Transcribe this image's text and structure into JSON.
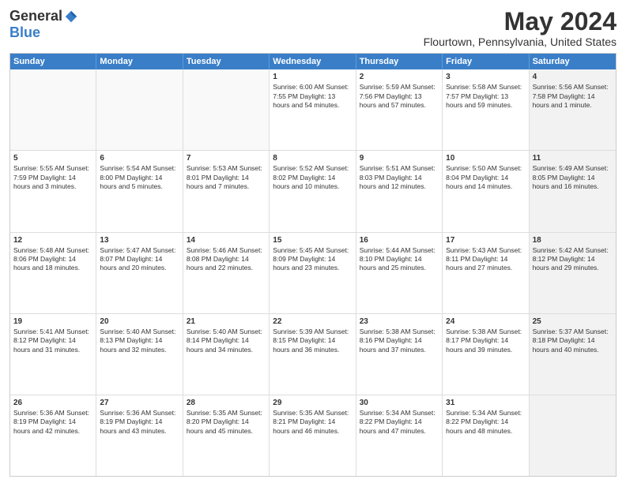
{
  "header": {
    "logo": {
      "general": "General",
      "blue": "Blue"
    },
    "title": "May 2024",
    "location": "Flourtown, Pennsylvania, United States"
  },
  "weekdays": [
    "Sunday",
    "Monday",
    "Tuesday",
    "Wednesday",
    "Thursday",
    "Friday",
    "Saturday"
  ],
  "rows": [
    [
      {
        "day": "",
        "info": "",
        "empty": true
      },
      {
        "day": "",
        "info": "",
        "empty": true
      },
      {
        "day": "",
        "info": "",
        "empty": true
      },
      {
        "day": "1",
        "info": "Sunrise: 6:00 AM\nSunset: 7:55 PM\nDaylight: 13 hours\nand 54 minutes.",
        "empty": false
      },
      {
        "day": "2",
        "info": "Sunrise: 5:59 AM\nSunset: 7:56 PM\nDaylight: 13 hours\nand 57 minutes.",
        "empty": false
      },
      {
        "day": "3",
        "info": "Sunrise: 5:58 AM\nSunset: 7:57 PM\nDaylight: 13 hours\nand 59 minutes.",
        "empty": false
      },
      {
        "day": "4",
        "info": "Sunrise: 5:56 AM\nSunset: 7:58 PM\nDaylight: 14 hours\nand 1 minute.",
        "empty": false,
        "shaded": true
      }
    ],
    [
      {
        "day": "5",
        "info": "Sunrise: 5:55 AM\nSunset: 7:59 PM\nDaylight: 14 hours\nand 3 minutes.",
        "empty": false
      },
      {
        "day": "6",
        "info": "Sunrise: 5:54 AM\nSunset: 8:00 PM\nDaylight: 14 hours\nand 5 minutes.",
        "empty": false
      },
      {
        "day": "7",
        "info": "Sunrise: 5:53 AM\nSunset: 8:01 PM\nDaylight: 14 hours\nand 7 minutes.",
        "empty": false
      },
      {
        "day": "8",
        "info": "Sunrise: 5:52 AM\nSunset: 8:02 PM\nDaylight: 14 hours\nand 10 minutes.",
        "empty": false
      },
      {
        "day": "9",
        "info": "Sunrise: 5:51 AM\nSunset: 8:03 PM\nDaylight: 14 hours\nand 12 minutes.",
        "empty": false
      },
      {
        "day": "10",
        "info": "Sunrise: 5:50 AM\nSunset: 8:04 PM\nDaylight: 14 hours\nand 14 minutes.",
        "empty": false
      },
      {
        "day": "11",
        "info": "Sunrise: 5:49 AM\nSunset: 8:05 PM\nDaylight: 14 hours\nand 16 minutes.",
        "empty": false,
        "shaded": true
      }
    ],
    [
      {
        "day": "12",
        "info": "Sunrise: 5:48 AM\nSunset: 8:06 PM\nDaylight: 14 hours\nand 18 minutes.",
        "empty": false
      },
      {
        "day": "13",
        "info": "Sunrise: 5:47 AM\nSunset: 8:07 PM\nDaylight: 14 hours\nand 20 minutes.",
        "empty": false
      },
      {
        "day": "14",
        "info": "Sunrise: 5:46 AM\nSunset: 8:08 PM\nDaylight: 14 hours\nand 22 minutes.",
        "empty": false
      },
      {
        "day": "15",
        "info": "Sunrise: 5:45 AM\nSunset: 8:09 PM\nDaylight: 14 hours\nand 23 minutes.",
        "empty": false
      },
      {
        "day": "16",
        "info": "Sunrise: 5:44 AM\nSunset: 8:10 PM\nDaylight: 14 hours\nand 25 minutes.",
        "empty": false
      },
      {
        "day": "17",
        "info": "Sunrise: 5:43 AM\nSunset: 8:11 PM\nDaylight: 14 hours\nand 27 minutes.",
        "empty": false
      },
      {
        "day": "18",
        "info": "Sunrise: 5:42 AM\nSunset: 8:12 PM\nDaylight: 14 hours\nand 29 minutes.",
        "empty": false,
        "shaded": true
      }
    ],
    [
      {
        "day": "19",
        "info": "Sunrise: 5:41 AM\nSunset: 8:12 PM\nDaylight: 14 hours\nand 31 minutes.",
        "empty": false
      },
      {
        "day": "20",
        "info": "Sunrise: 5:40 AM\nSunset: 8:13 PM\nDaylight: 14 hours\nand 32 minutes.",
        "empty": false
      },
      {
        "day": "21",
        "info": "Sunrise: 5:40 AM\nSunset: 8:14 PM\nDaylight: 14 hours\nand 34 minutes.",
        "empty": false
      },
      {
        "day": "22",
        "info": "Sunrise: 5:39 AM\nSunset: 8:15 PM\nDaylight: 14 hours\nand 36 minutes.",
        "empty": false
      },
      {
        "day": "23",
        "info": "Sunrise: 5:38 AM\nSunset: 8:16 PM\nDaylight: 14 hours\nand 37 minutes.",
        "empty": false
      },
      {
        "day": "24",
        "info": "Sunrise: 5:38 AM\nSunset: 8:17 PM\nDaylight: 14 hours\nand 39 minutes.",
        "empty": false
      },
      {
        "day": "25",
        "info": "Sunrise: 5:37 AM\nSunset: 8:18 PM\nDaylight: 14 hours\nand 40 minutes.",
        "empty": false,
        "shaded": true
      }
    ],
    [
      {
        "day": "26",
        "info": "Sunrise: 5:36 AM\nSunset: 8:19 PM\nDaylight: 14 hours\nand 42 minutes.",
        "empty": false
      },
      {
        "day": "27",
        "info": "Sunrise: 5:36 AM\nSunset: 8:19 PM\nDaylight: 14 hours\nand 43 minutes.",
        "empty": false
      },
      {
        "day": "28",
        "info": "Sunrise: 5:35 AM\nSunset: 8:20 PM\nDaylight: 14 hours\nand 45 minutes.",
        "empty": false
      },
      {
        "day": "29",
        "info": "Sunrise: 5:35 AM\nSunset: 8:21 PM\nDaylight: 14 hours\nand 46 minutes.",
        "empty": false
      },
      {
        "day": "30",
        "info": "Sunrise: 5:34 AM\nSunset: 8:22 PM\nDaylight: 14 hours\nand 47 minutes.",
        "empty": false
      },
      {
        "day": "31",
        "info": "Sunrise: 5:34 AM\nSunset: 8:22 PM\nDaylight: 14 hours\nand 48 minutes.",
        "empty": false
      },
      {
        "day": "",
        "info": "",
        "empty": true,
        "shaded": true
      }
    ]
  ]
}
